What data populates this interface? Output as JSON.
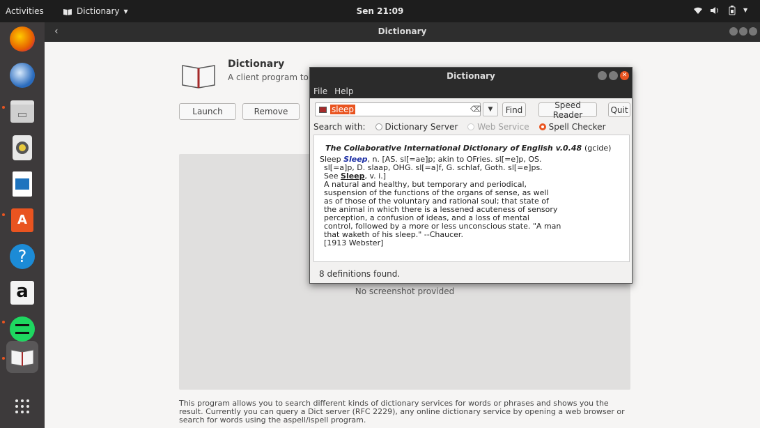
{
  "topbar": {
    "activities": "Activities",
    "app_menu": "Dictionary",
    "clock": "Sen 21:09"
  },
  "dock": {
    "items": [
      {
        "name": "firefox",
        "color": "#e66000"
      },
      {
        "name": "thunderbird",
        "color": "#2a6bbd"
      },
      {
        "name": "files",
        "color": "#bdbdbd"
      },
      {
        "name": "rhythmbox",
        "color": "#e8c93c"
      },
      {
        "name": "libreoffice-writer",
        "color": "#1e73be"
      },
      {
        "name": "software",
        "color": "#e95420"
      },
      {
        "name": "help",
        "color": "#1c8bd6"
      },
      {
        "name": "amazon",
        "color": "#f3f3f3"
      },
      {
        "name": "spotify",
        "color": "#1ed760"
      },
      {
        "name": "dictionary",
        "color": "#efefef"
      },
      {
        "name": "show-apps",
        "color": "#3d3a3b"
      }
    ]
  },
  "software": {
    "header_title": "Dictionary",
    "app_name": "Dictionary",
    "app_summary": "A client program to query",
    "launch_label": "Launch",
    "remove_label": "Remove",
    "screenshot_label": "No screenshot provided",
    "description": "This program allows you to search different kinds of dictionary services for words or phrases and shows you the result. Currently you can query a Dict server (RFC 2229), any online dictionary service by opening a web browser or search for words using the aspell/ispell program."
  },
  "dialog": {
    "title": "Dictionary",
    "menu": {
      "file": "File",
      "help": "Help"
    },
    "search_value": "sleep",
    "find_label": "Find",
    "speed_reader_label": "Speed Reader",
    "quit_label": "Quit",
    "search_with_label": "Search with:",
    "sources": {
      "dict_server": "Dictionary Server",
      "web_service": "Web Service",
      "spell_checker": "Spell Checker"
    },
    "selected_source": "Spell Checker",
    "result": {
      "database": "The Collaborative International Dictionary of English v.0.48",
      "database_id": "(gcide)",
      "headword_prefix": "Sleep",
      "headword": "Sleep",
      "etym1": ", n. [AS. sl[=ae]p; akin to OFries. sl[=e]p, OS.",
      "etym2": "sl[=a]p, D. slaap, OHG. sl[=a]f, G. schlaf, Goth. sl[=e]ps.",
      "see_prefix": "See",
      "see_link": "Sleep",
      "see_suffix": ", v. i.]",
      "definition_lines": [
        "A natural and healthy, but temporary and periodical,",
        "suspension of the functions of the organs of sense, as well",
        "as of those of the voluntary and rational soul; that state of",
        "the animal in which there is a lessened acuteness of sensory",
        "perception, a confusion of ideas, and a loss of mental",
        "control, followed by a more or less unconscious state. \"A man",
        "that waketh of his sleep.\" --Chaucer.",
        "[1913 Webster]"
      ]
    },
    "status": "8 definitions found."
  }
}
